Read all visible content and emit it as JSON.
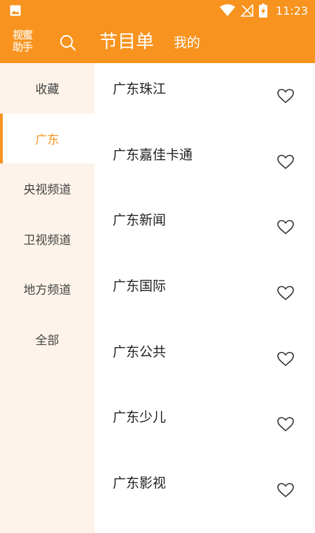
{
  "status_bar": {
    "time": "11:23"
  },
  "app_bar": {
    "logo_line1": "视蜜",
    "logo_line2": "助手",
    "title": "节目单",
    "mine_label": "我的"
  },
  "sidebar": {
    "items": [
      {
        "label": "收藏",
        "active": false
      },
      {
        "label": "广东",
        "active": true
      },
      {
        "label": "央视频道",
        "active": false
      },
      {
        "label": "卫视频道",
        "active": false
      },
      {
        "label": "地方频道",
        "active": false
      },
      {
        "label": "全部",
        "active": false
      }
    ]
  },
  "channels": [
    {
      "name": "广东珠江"
    },
    {
      "name": "广东嘉佳卡通"
    },
    {
      "name": "广东新闻"
    },
    {
      "name": "广东国际"
    },
    {
      "name": "广东公共"
    },
    {
      "name": "广东少儿"
    },
    {
      "name": "广东影视"
    }
  ],
  "colors": {
    "accent": "#f7931e",
    "sidebar_bg": "#fdf3ea"
  }
}
